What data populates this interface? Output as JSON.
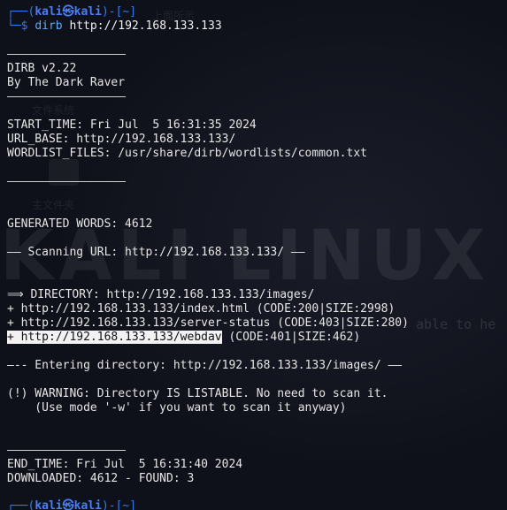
{
  "prompt": {
    "top_open": "┌──(",
    "user": "kali㉿kali",
    "top_close": ")-[~]",
    "bottom": "└─$",
    "command": "dirb",
    "argument": "http://192.168.133.133"
  },
  "output": {
    "banner_title": "DIRB v2.22",
    "banner_author": "By The Dark Raver",
    "start_time": "START_TIME: Fri Jul  5 16:31:35 2024",
    "url_base": "URL_BASE: http://192.168.133.133/",
    "wordlist": "WORDLIST_FILES: /usr/share/dirb/wordlists/common.txt",
    "generated_words": "GENERATED WORDS: 4612",
    "scanning": "—— Scanning URL: http://192.168.133.133/ ——",
    "dir_found": "⟹ DIRECTORY: http://192.168.133.133/images/",
    "hits": [
      "+ http://192.168.133.133/index.html (CODE:200|SIZE:2998)",
      "+ http://192.168.133.133/server-status (CODE:403|SIZE:280)"
    ],
    "hit_webdav_url": "+ http://192.168.133.133/webdav",
    "hit_webdav_info": " (CODE:401|SIZE:462)",
    "entering": "—-- Entering directory: http://192.168.133.133/images/ ——",
    "warning1": "(!) WARNING: Directory IS LISTABLE. No need to scan it.",
    "warning2": "    (Use mode '-w' if you want to scan it anyway)",
    "end_time": "END_TIME: Fri Jul  5 16:31:40 2024",
    "downloaded": "DOWNLOADED: 4612 - FOUND: 3"
  },
  "background": {
    "watermark": "KALI LINUX",
    "tagline": "able to he",
    "ghost1": "文件系统",
    "ghost2": "主文件夹",
    "ghost3": "上面所示"
  },
  "colors": {
    "background": "#0f111a",
    "prompt": "#2f7bf0",
    "command": "#5fa8ff",
    "text": "#e6e6e6"
  }
}
